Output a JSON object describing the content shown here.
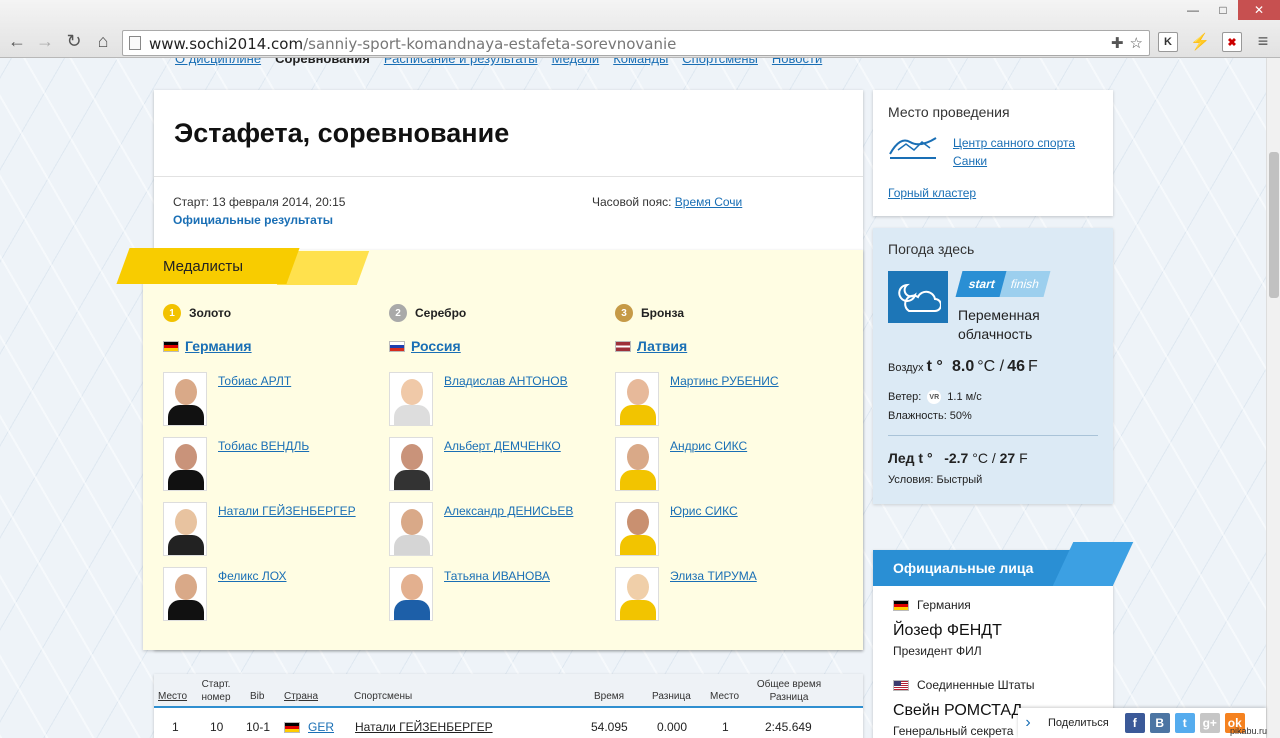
{
  "browser": {
    "url_domain": "www.sochi2014.com",
    "url_path": "/sanniy-sport-komandnaya-estafeta-sorevnovanie",
    "extensions": [
      "K",
      "⚡",
      "✖"
    ]
  },
  "event": {
    "title": "Эстафета, соревнование",
    "start": "Старт: 13 февраля 2014, 20:15",
    "official_results": "Официальные результаты",
    "timezone_label": "Часовой пояс:",
    "timezone_value": "Время Сочи"
  },
  "medalists": {
    "heading": "Медалисты",
    "columns": [
      {
        "medal": "Золото",
        "medal_num": "1",
        "country": "Германия",
        "flag": "de",
        "athletes": [
          "Тобиас АРЛТ",
          "Тобиас ВЕНДЛЬ",
          "Натали ГЕЙЗЕНБЕРГЕР",
          "Феликс ЛОХ"
        ]
      },
      {
        "medal": "Серебро",
        "medal_num": "2",
        "country": "Россия",
        "flag": "ru",
        "athletes": [
          "Владислав АНТОНОВ",
          "Альберт ДЕМЧЕНКО",
          "Александр ДЕНИСЬЕВ",
          "Татьяна ИВАНОВА"
        ]
      },
      {
        "medal": "Бронза",
        "medal_num": "3",
        "country": "Латвия",
        "flag": "lv",
        "athletes": [
          "Мартинс РУБЕНИС",
          "Андрис СИКС",
          "Юрис СИКС",
          "Элиза ТИРУМА"
        ]
      }
    ]
  },
  "results": {
    "headers": [
      "Место",
      "Старт. номер",
      "Bib",
      "Страна",
      "Спортсмены",
      "Время",
      "Разница",
      "Место",
      "Общее время Разница"
    ],
    "row": [
      "1",
      "10",
      "10-1",
      "GER",
      "Натали ГЕЙЗЕНБЕРГЕР",
      "54.095",
      "0.000",
      "1",
      "2:45.649"
    ]
  },
  "venue": {
    "label": "Место проведения",
    "name": "Центр санного спорта Санки",
    "cluster": "Горный кластер"
  },
  "weather": {
    "label": "Погода здесь",
    "tab_start": "start",
    "tab_finish": "finish",
    "condition": "Переменная облачность",
    "air_label": "Воздух",
    "t_label": "t °",
    "air_c": "8.0",
    "c_unit": "°C /",
    "air_f": "46",
    "f_unit": "F",
    "wind_label": "Ветер:",
    "wind_dir": "VR",
    "wind_speed": "1.1 м/с",
    "humidity": "Влажность: 50%",
    "ice_label": "Лед",
    "ice_c": "-2.7",
    "ice_f": "27",
    "conditions": "Условия: Быстрый"
  },
  "officials": {
    "heading": "Официальные лица",
    "people": [
      {
        "country": "Германия",
        "flag": "de",
        "name": "Йозеф ФЕНДТ",
        "role": "Президент ФИЛ"
      },
      {
        "country": "Соединенные Штаты",
        "flag": "us",
        "name": "Свейн РОМСТАД",
        "role": "Генеральный секрета"
      }
    ]
  },
  "share": {
    "label": "Поделиться",
    "networks": [
      "f",
      "B",
      "t",
      "g+",
      "ok"
    ],
    "colors": [
      "#3b5998",
      "#4c75a3",
      "#55acee",
      "#c6c6c6",
      "#f58220"
    ]
  },
  "watermark": "pikabu.ru",
  "topnav": [
    "О дисциплине",
    "Соревнования",
    "Расписание и результаты",
    "Медали",
    "Команды",
    "Спортсмены",
    "Новости"
  ]
}
